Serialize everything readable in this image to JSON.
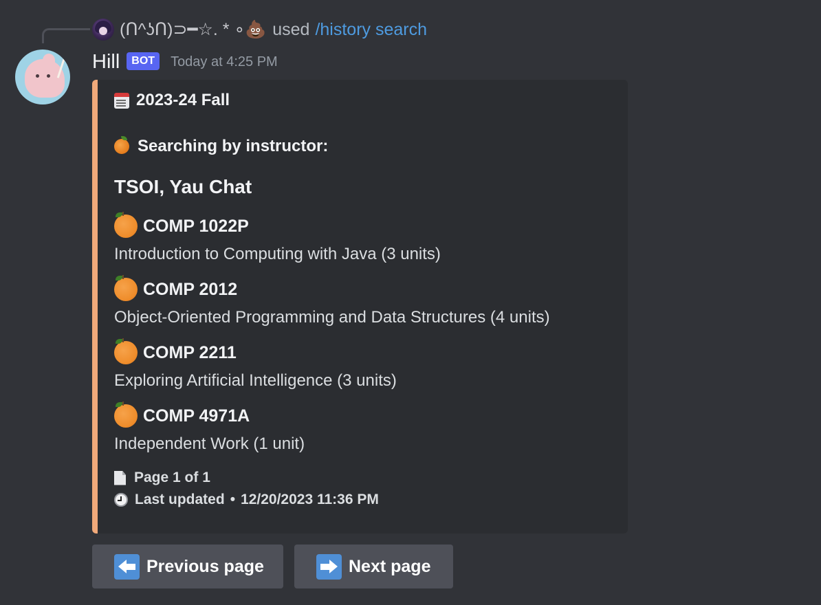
{
  "reply": {
    "username": "(ᑎ^ʖᑎ)⊃━☆. * ∘💩",
    "used_text": "used",
    "command": "/history search"
  },
  "message": {
    "author": "Hill",
    "bot_tag": "BOT",
    "timestamp": "Today at 4:25 PM"
  },
  "embed": {
    "accent_color": "#f0a97a",
    "term": "2023-24 Fall",
    "search_mode": "Searching by instructor:",
    "instructor": "TSOI, Yau Chat",
    "courses": [
      {
        "code": "COMP 1022P",
        "description": "Introduction to Computing with Java (3 units)"
      },
      {
        "code": "COMP 2012",
        "description": "Object-Oriented Programming and Data Structures (4 units)"
      },
      {
        "code": "COMP 2211",
        "description": "Exploring Artificial Intelligence (3 units)"
      },
      {
        "code": "COMP 4971A",
        "description": "Independent Work (1 unit)"
      }
    ],
    "page_info": "Page 1 of 1",
    "last_updated_label": "Last updated",
    "last_updated_separator": "•",
    "last_updated_value": "12/20/2023 11:36 PM"
  },
  "buttons": {
    "previous_label": "Previous page",
    "next_label": "Next page"
  },
  "icons": {
    "term": "calendar-icon",
    "search": "tangerine-icon",
    "course": "orange-icon",
    "page": "page-icon",
    "updated": "clock-icon",
    "previous": "left-arrow-icon",
    "next": "right-arrow-icon"
  }
}
